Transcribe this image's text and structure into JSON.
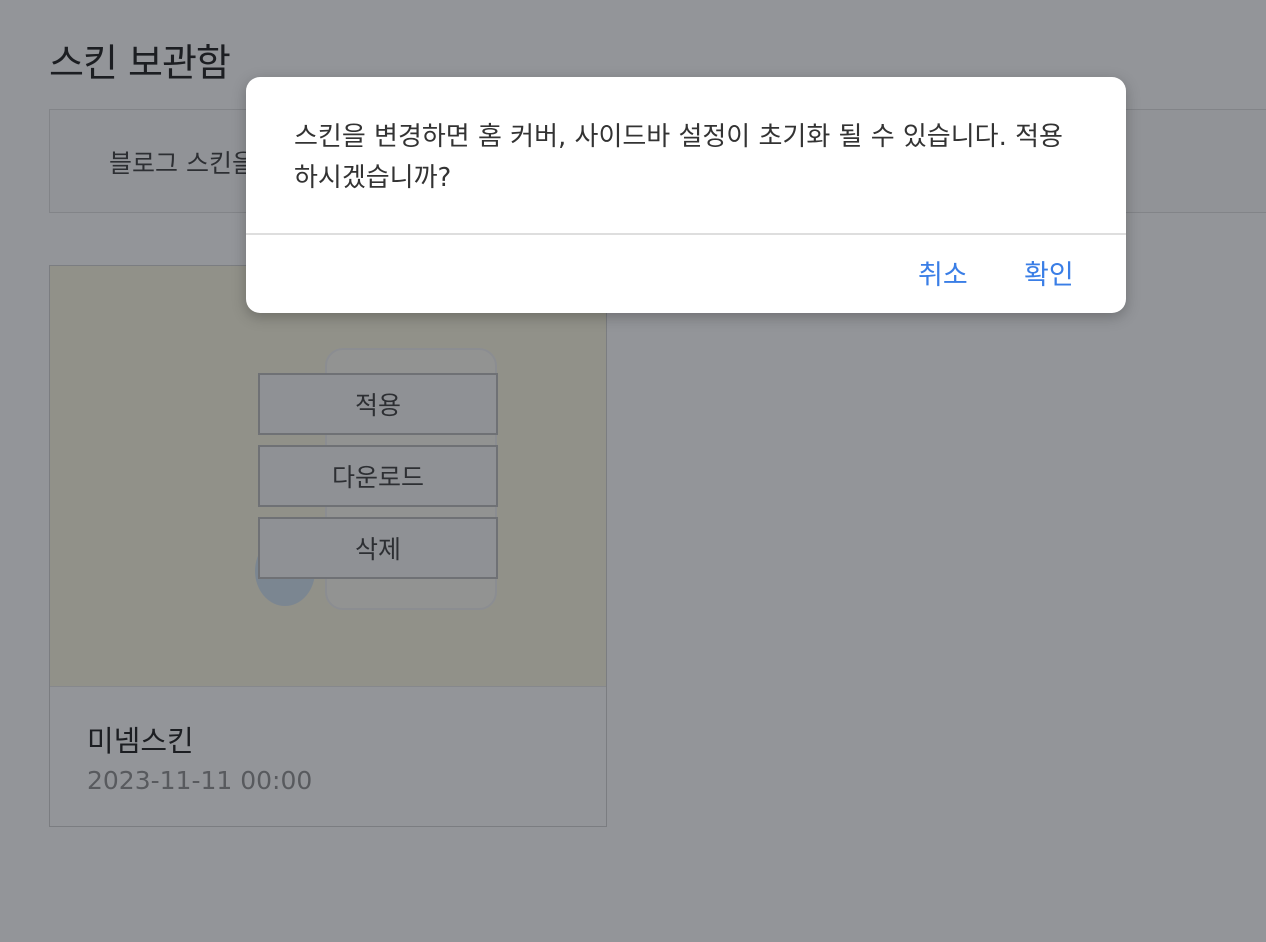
{
  "page": {
    "title": "스킨 보관함"
  },
  "info": {
    "text": "블로그 스킨을"
  },
  "skin_card": {
    "name": "미넴스킨",
    "date": "2023-11-11 00:00",
    "buttons": {
      "apply": "적용",
      "download": "다운로드",
      "delete": "삭제"
    }
  },
  "dialog": {
    "message": "스킨을 변경하면 홈 커버, 사이드바 설정이 초기화 될 수 있습니다. 적용하시겠습니까?",
    "cancel_label": "취소",
    "confirm_label": "확인",
    "accent_color": "#3a7ee6"
  }
}
